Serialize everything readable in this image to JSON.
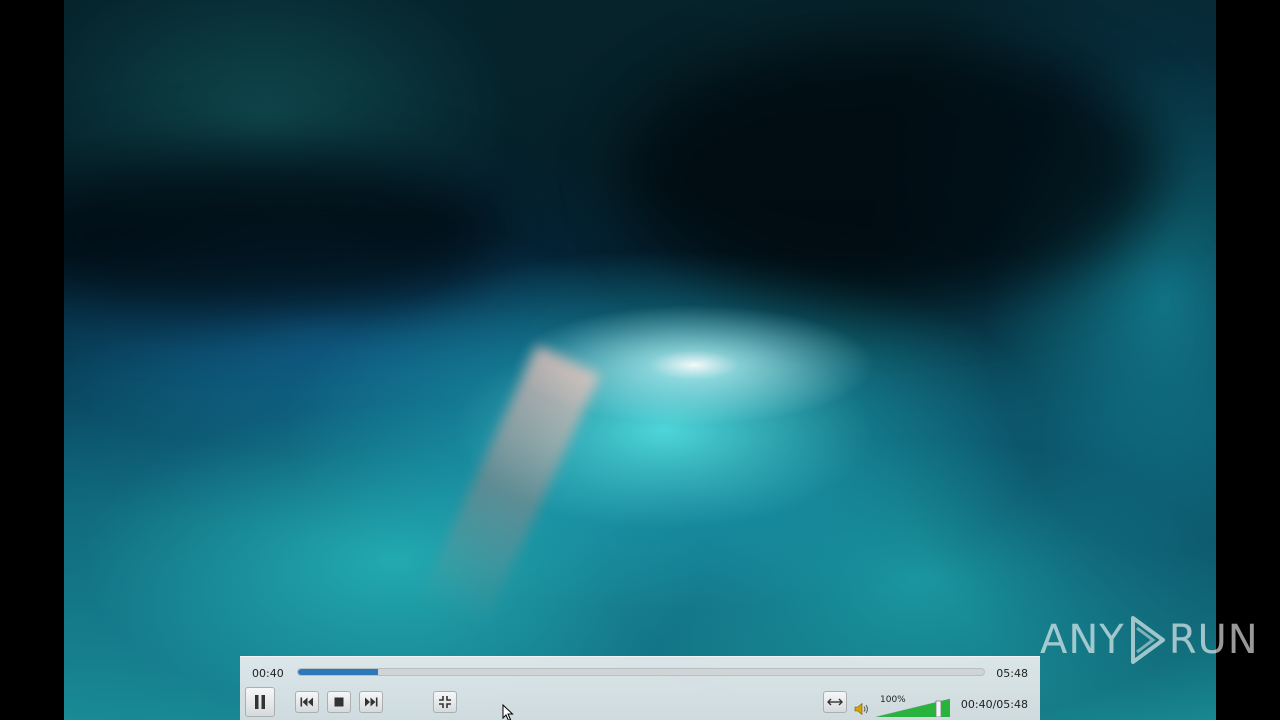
{
  "player": {
    "elapsed": "00:40",
    "duration": "05:48",
    "elapsed_duration": "00:40/05:48",
    "progress_fraction": 0.117,
    "volume_label": "100%",
    "volume_fraction": 1.0
  },
  "controls": {
    "pause_icon": "pause-icon",
    "previous_icon": "skip-previous-icon",
    "stop_icon": "stop-icon",
    "next_icon": "skip-next-icon",
    "fullscreen_icon": "exit-fullscreen-icon",
    "aspect_icon": "stretch-icon",
    "speaker_icon": "speaker-icon"
  },
  "watermark": {
    "left_text": "ANY",
    "right_text": "RUN"
  },
  "colors": {
    "seek_fill": "#2f78b8",
    "volume_fill": "#28b33c"
  }
}
